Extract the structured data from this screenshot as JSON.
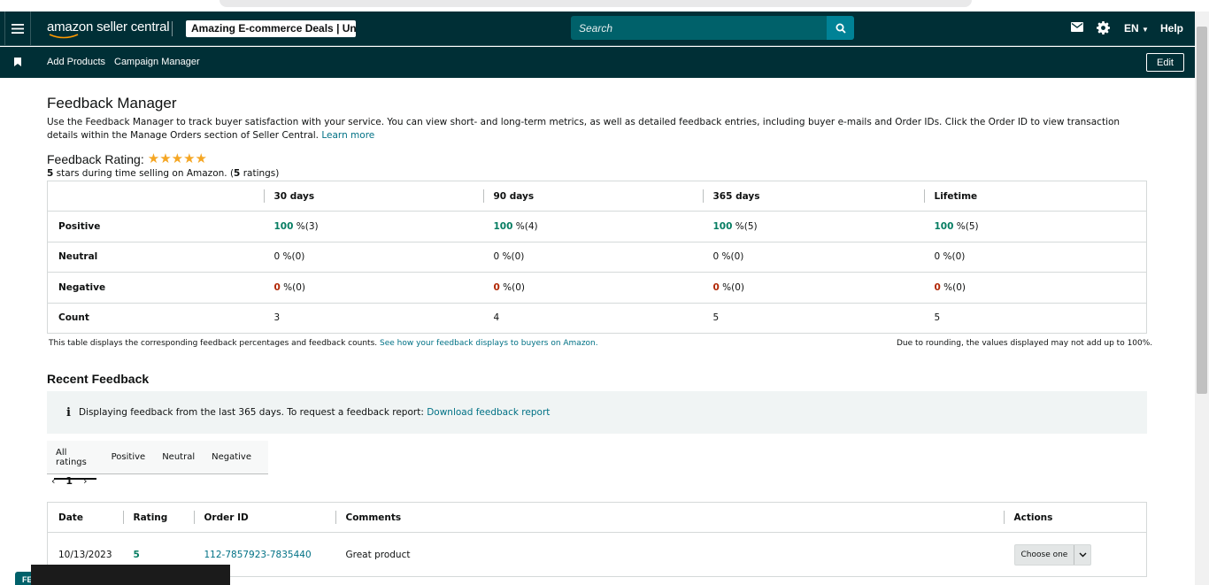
{
  "topbar": {
    "logo_text": "amazon seller central",
    "store_name": "Amazing E-commerce Deals | Uni...",
    "search_placeholder": "Search",
    "language": "EN",
    "help": "Help"
  },
  "navbar": {
    "items": [
      "Add Products",
      "Campaign Manager"
    ],
    "edit_label": "Edit"
  },
  "page": {
    "title": "Feedback Manager",
    "intro": "Use the Feedback Manager to track buyer satisfaction with your service. You can view short- and long-term metrics, as well as detailed feedback entries, including buyer e-mails and Order IDs. Click the Order ID to view transaction details within the Manage Orders section of Seller Central.",
    "learn_more": "Learn more"
  },
  "rating": {
    "label": "Feedback Rating:",
    "stars": 5,
    "stars_value": "5",
    "sub_text": "stars during time selling on Amazon. (",
    "count": "5",
    "sub_end": "ratings)"
  },
  "metrics": {
    "columns": [
      "30 days",
      "90 days",
      "365 days",
      "Lifetime"
    ],
    "rows": [
      {
        "label": "Positive",
        "cells": [
          {
            "v": "100",
            "s": " %(3)"
          },
          {
            "v": "100",
            "s": " %(4)"
          },
          {
            "v": "100",
            "s": " %(5)"
          },
          {
            "v": "100",
            "s": " %(5)"
          }
        ]
      },
      {
        "label": "Neutral",
        "cells": [
          {
            "v": "0",
            "s": " %(0)"
          },
          {
            "v": "0",
            "s": " %(0)"
          },
          {
            "v": "0",
            "s": " %(0)"
          },
          {
            "v": "0",
            "s": " %(0)"
          }
        ]
      },
      {
        "label": "Negative",
        "cells": [
          {
            "v": "0",
            "s": " %(0)"
          },
          {
            "v": "0",
            "s": " %(0)"
          },
          {
            "v": "0",
            "s": " %(0)"
          },
          {
            "v": "0",
            "s": " %(0)"
          }
        ]
      },
      {
        "label": "Count",
        "cells": [
          {
            "v": "3"
          },
          {
            "v": "4"
          },
          {
            "v": "5"
          },
          {
            "v": "5"
          }
        ]
      }
    ],
    "note_left": "This table displays the corresponding feedback percentages and feedback counts.",
    "note_left_link": "See how your feedback displays to buyers on Amazon.",
    "note_right": "Due to rounding, the values displayed may not add up to 100%."
  },
  "recent": {
    "title": "Recent Feedback",
    "info_text": "Displaying feedback from the last 365 days. To request a feedback report:",
    "info_link": "Download feedback report",
    "tabs": [
      "All ratings",
      "Positive",
      "Neutral",
      "Negative"
    ],
    "page": "1",
    "columns": [
      "Date",
      "Rating",
      "Order ID",
      "Comments",
      "Actions"
    ],
    "rows": [
      {
        "date": "10/13/2023",
        "rating": "5",
        "order_id": "112-7857923-7835440",
        "comment": "Great product",
        "action": "Choose one"
      }
    ]
  },
  "footer_badge": "FE",
  "colors": {
    "header_bg": "#002f36",
    "link": "#007185",
    "positive": "#067d62",
    "negative": "#b12704",
    "star": "#f5a623"
  }
}
